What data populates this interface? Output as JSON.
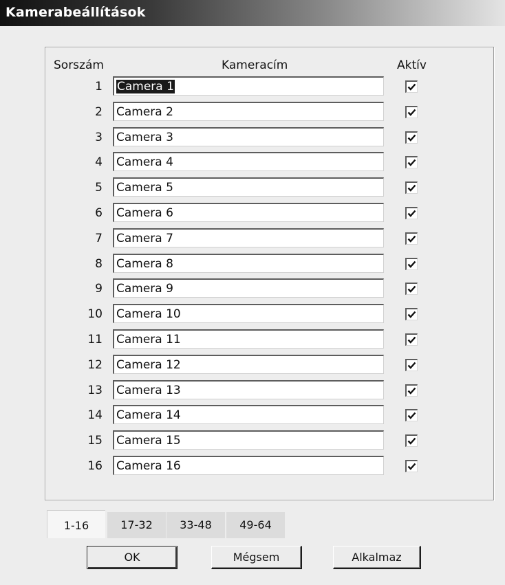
{
  "window": {
    "title": "Kamerabeállítások"
  },
  "columns": {
    "index": "Sorszám",
    "name": "Kameracím",
    "active": "Aktív"
  },
  "cameras": [
    {
      "no": "1",
      "name": "Camera 1",
      "active": true
    },
    {
      "no": "2",
      "name": "Camera 2",
      "active": true
    },
    {
      "no": "3",
      "name": "Camera 3",
      "active": true
    },
    {
      "no": "4",
      "name": "Camera 4",
      "active": true
    },
    {
      "no": "5",
      "name": "Camera 5",
      "active": true
    },
    {
      "no": "6",
      "name": "Camera 6",
      "active": true
    },
    {
      "no": "7",
      "name": "Camera 7",
      "active": true
    },
    {
      "no": "8",
      "name": "Camera 8",
      "active": true
    },
    {
      "no": "9",
      "name": "Camera 9",
      "active": true
    },
    {
      "no": "10",
      "name": "Camera 10",
      "active": true
    },
    {
      "no": "11",
      "name": "Camera 11",
      "active": true
    },
    {
      "no": "12",
      "name": "Camera 12",
      "active": true
    },
    {
      "no": "13",
      "name": "Camera 13",
      "active": true
    },
    {
      "no": "14",
      "name": "Camera 14",
      "active": true
    },
    {
      "no": "15",
      "name": "Camera 15",
      "active": true
    },
    {
      "no": "16",
      "name": "Camera 16",
      "active": true
    }
  ],
  "tabs": [
    {
      "label": "1-16",
      "active": true
    },
    {
      "label": "17-32",
      "active": false
    },
    {
      "label": "33-48",
      "active": false
    },
    {
      "label": "49-64",
      "active": false
    }
  ],
  "buttons": {
    "ok": "OK",
    "cancel": "Mégsem",
    "apply": "Alkalmaz"
  },
  "icons": {
    "checkbox_checked": "checkmark-icon"
  }
}
